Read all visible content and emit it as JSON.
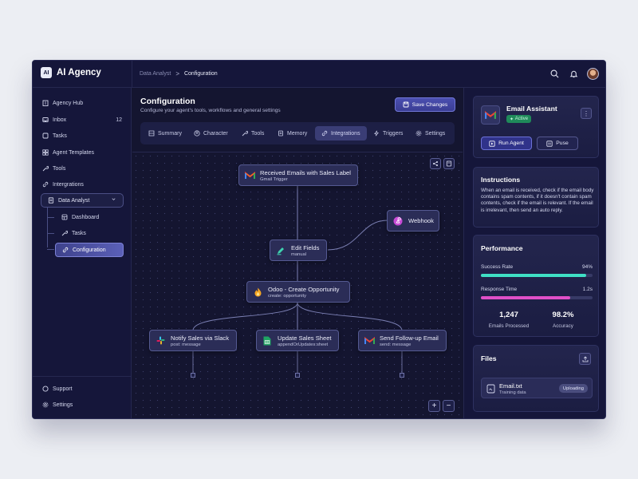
{
  "app": {
    "logo_text": "AI",
    "name": "AI Agency"
  },
  "breadcrumb": {
    "parent": "Data Analyst",
    "separator": ">",
    "current": "Configuration"
  },
  "sidebar": {
    "items": [
      {
        "label": "Agency Hub",
        "icon": "building-icon"
      },
      {
        "label": "Inbox",
        "icon": "inbox-icon",
        "badge": "12"
      },
      {
        "label": "Tasks",
        "icon": "tasks-icon"
      },
      {
        "label": "Agent Templates",
        "icon": "templates-icon"
      },
      {
        "label": "Tools",
        "icon": "wrench-icon"
      },
      {
        "label": "Intergrations",
        "icon": "link-icon"
      }
    ],
    "group": {
      "label": "Data Analyst",
      "expanded": true
    },
    "sub_items": [
      {
        "label": "Dashboard",
        "active": false
      },
      {
        "label": "Tasks",
        "active": false
      },
      {
        "label": "Configuration",
        "active": true
      }
    ],
    "bottom": [
      {
        "label": "Support"
      },
      {
        "label": "Settings"
      }
    ]
  },
  "main": {
    "title": "Configuration",
    "subtitle": "Configure your agent's tools, workflows and general settings",
    "save_label": "Save Changes",
    "tabs": [
      {
        "label": "Summary",
        "active": false
      },
      {
        "label": "Character",
        "active": false
      },
      {
        "label": "Tools",
        "active": false
      },
      {
        "label": "Memory",
        "active": false
      },
      {
        "label": "Integrations",
        "active": true
      },
      {
        "label": "Triggers",
        "active": false
      },
      {
        "label": "Settings",
        "active": false
      }
    ],
    "zoom_in": "+",
    "zoom_out": "−"
  },
  "workflow": {
    "nodes": [
      {
        "id": "trigger",
        "title": "Received Emails with Sales Label",
        "subtitle": "Gmail Trigger",
        "icon": "gmail-icon"
      },
      {
        "id": "webhook",
        "title": "Webhook",
        "subtitle": "",
        "icon": "webhook-icon"
      },
      {
        "id": "edit",
        "title": "Edit Fields",
        "subtitle": "manual",
        "icon": "pen-icon"
      },
      {
        "id": "odoo",
        "title": "Odoo - Create Opportunity",
        "subtitle": "create: opportunity",
        "icon": "fire-icon"
      },
      {
        "id": "slack",
        "title": "Notify Sales via Slack",
        "subtitle": "post: message",
        "icon": "slack-icon"
      },
      {
        "id": "sheet",
        "title": "Update Sales Sheet",
        "subtitle": "appendOrUpdates:sheet",
        "icon": "sheets-icon"
      },
      {
        "id": "followup",
        "title": "Send Follow-up Email",
        "subtitle": "send: message",
        "icon": "gmail-icon"
      }
    ]
  },
  "agent": {
    "name": "Email Assistant",
    "status": "Active",
    "run_label": "Run Agent",
    "pause_label": "Puse",
    "more": "⋮"
  },
  "instructions": {
    "title": "Instructions",
    "text": "When an email is received, check if the email body contains spam contents, if it doesn't contain spam contents, check if the email is relevant. If the email is irrelevant, then send an auto reply."
  },
  "performance": {
    "title": "Performance",
    "metrics": [
      {
        "label": "Success Rate",
        "value": "94%",
        "fraction": 0.94,
        "color": "#3fe0c5"
      },
      {
        "label": "Response Time",
        "value": "1.2s",
        "fraction": 0.8,
        "color": "#e04fc8"
      }
    ],
    "stats": [
      {
        "value": "1,247",
        "label": "Emails Processed"
      },
      {
        "value": "98.2%",
        "label": "Accuracy"
      }
    ]
  },
  "files": {
    "title": "Files",
    "items": [
      {
        "name": "Email.txt",
        "type": "Training data",
        "status": "Uploading"
      }
    ]
  }
}
